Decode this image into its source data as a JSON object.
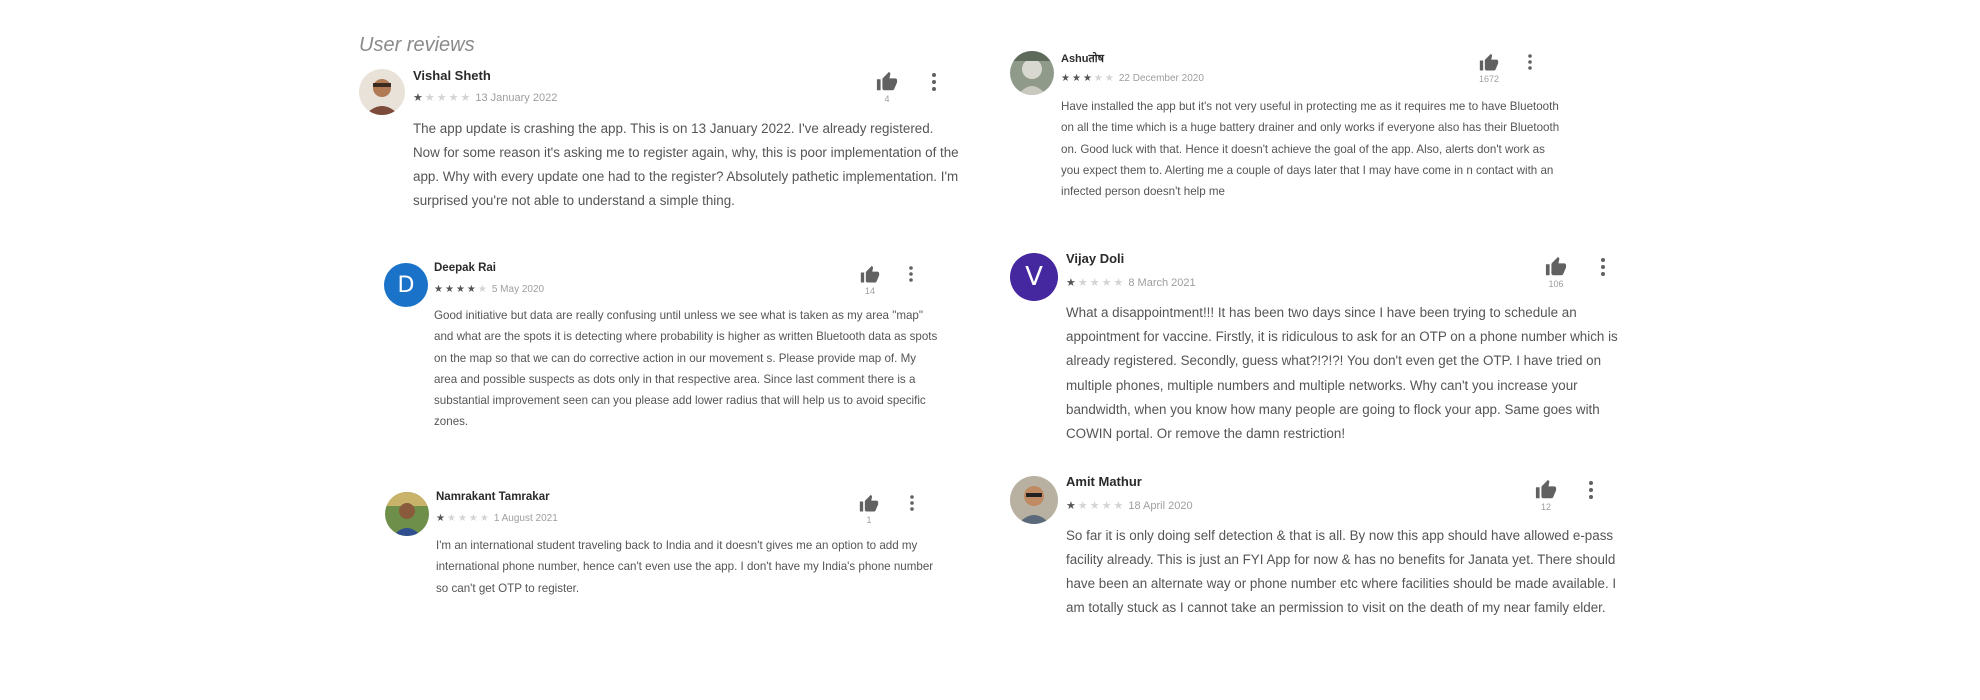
{
  "section_title": "User reviews",
  "colors": {
    "star_filled": "#555555",
    "star_empty": "#d4d4d4",
    "avatar_blue": "#1a73c8",
    "avatar_purple": "#4527a0"
  },
  "reviews": [
    {
      "name": "Vishal Sheth",
      "avatar": "photo",
      "rating": 1,
      "date": "13 January 2022",
      "likes": "4",
      "text": "The app update is crashing the app. This is on 13 January 2022. I've already registered. Now for some reason it's asking me to register again, why, this is poor implementation of the app. Why with every update one had to the register? Absolutely pathetic implementation. I'm surprised you're not able to understand a simple thing."
    },
    {
      "name": "Ashutosh",
      "name_display": "Ashuतोष",
      "avatar": "photo",
      "rating": 3,
      "date": "22 December 2020",
      "likes": "1672",
      "text": "Have installed the app but it's not very useful in protecting me as it requires me to have Bluetooth on all the time which is a huge battery drainer and only works if everyone also has their Bluetooth on. Good luck with that. Hence it doesn't achieve the goal of the app. Also, alerts don't work as you expect them to. Alerting me a couple of days later that I may have come in n contact with an infected person doesn't help me"
    },
    {
      "name": "Deepak Rai",
      "avatar": "letter",
      "avatar_letter": "D",
      "rating": 4,
      "date": "5 May 2020",
      "likes": "14",
      "text": "Good initiative but data are really confusing until unless we see what is taken as my area \"map\" and what are the spots it is detecting where probability is higher as written Bluetooth data as spots on the map so that we can do corrective action in our movement s. Please provide map of. My area and possible suspects as dots only in that respective area. Since last comment there is a substantial improvement seen can you please add lower radius that will help us to avoid specific zones."
    },
    {
      "name": "Vijay Doli",
      "avatar": "letter",
      "avatar_letter": "V",
      "rating": 1,
      "date": "8 March 2021",
      "likes": "106",
      "text": "What a disappointment!!! It has been two days since I have been trying to schedule an appointment for vaccine. Firstly, it is ridiculous to ask for an OTP on a phone number which is already registered. Secondly, guess what?!?!?! You don't even get the OTP. I have tried on multiple phones, multiple numbers and multiple networks. Why can't you increase your bandwidth, when you know how many people are going to flock your app. Same goes with COWIN portal. Or remove the damn restriction!"
    },
    {
      "name": "Namrakant Tamrakar",
      "avatar": "photo",
      "rating": 1,
      "date": "1 August 2021",
      "likes": "1",
      "text": "I'm an international student traveling back to India and it doesn't gives me an option to add my international phone number, hence can't even use the app. I don't have my India's phone number so can't get OTP to register."
    },
    {
      "name": "Amit Mathur",
      "avatar": "photo",
      "rating": 1,
      "date": "18 April 2020",
      "likes": "12",
      "text": "So far it is only doing self detection & that is all. By now this app should have allowed e-pass facility already. This is just an FYI App for now & has no benefits for Janata yet. There should have been an alternate way or phone number etc where facilities should be made available. I am totally stuck as I cannot take an permission to visit on the death of my near family elder."
    }
  ]
}
